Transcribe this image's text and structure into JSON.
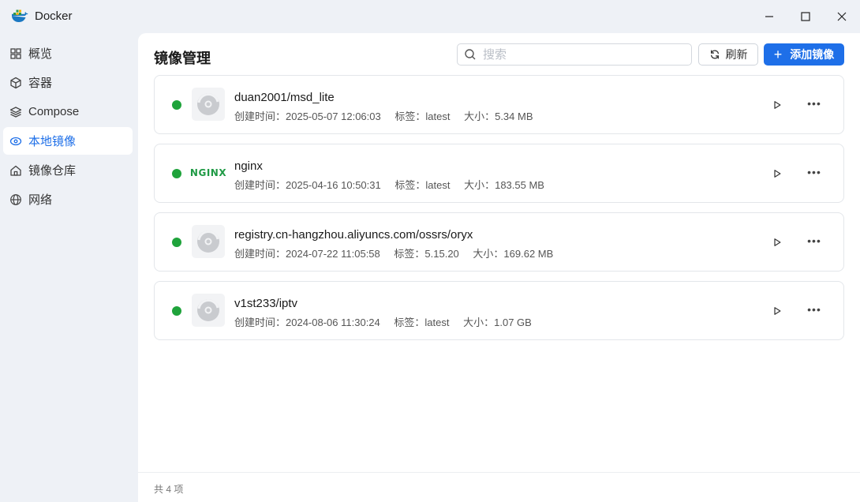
{
  "app": {
    "title": "Docker",
    "logo_icon": "docker-whale-icon"
  },
  "window_controls": [
    "minimize-icon",
    "maximize-icon",
    "close-icon"
  ],
  "sidebar": {
    "items": [
      {
        "label": "概览",
        "icon": "grid-icon",
        "active": false
      },
      {
        "label": "容器",
        "icon": "cube-icon",
        "active": false
      },
      {
        "label": "Compose",
        "icon": "layers-icon",
        "active": false
      },
      {
        "label": "本地镜像",
        "icon": "eye-disc-icon",
        "active": true
      },
      {
        "label": "镜像仓库",
        "icon": "home-icon",
        "active": false
      },
      {
        "label": "网络",
        "icon": "globe-icon",
        "active": false
      }
    ]
  },
  "main": {
    "title": "镜像管理",
    "search": {
      "placeholder": "搜索",
      "value": ""
    },
    "refresh_label": "刷新",
    "add_label": "添加镜像",
    "images": [
      {
        "name": "duan2001/msd_lite",
        "created_label": "创建时间：",
        "created": "2025-05-07 12:06:03",
        "tag_label": "标签：",
        "tag": "latest",
        "size_label": "大小：",
        "size": "5.34 MB",
        "icon": "disc-icon"
      },
      {
        "name": "nginx",
        "created_label": "创建时间：",
        "created": "2025-04-16 10:50:31",
        "tag_label": "标签：",
        "tag": "latest",
        "size_label": "大小：",
        "size": "183.55 MB",
        "icon": "nginx-logo",
        "logo_text": "NGINX"
      },
      {
        "name": "registry.cn-hangzhou.aliyuncs.com/ossrs/oryx",
        "created_label": "创建时间：",
        "created": "2024-07-22 11:05:58",
        "tag_label": "标签：",
        "tag": "5.15.20",
        "size_label": "大小：",
        "size": "169.62 MB",
        "icon": "disc-icon"
      },
      {
        "name": "v1st233/iptv",
        "created_label": "创建时间：",
        "created": "2024-08-06 11:30:24",
        "tag_label": "标签：",
        "tag": "latest",
        "size_label": "大小：",
        "size": "1.07 GB",
        "icon": "disc-icon"
      }
    ],
    "footer": "共 4 项"
  },
  "colors": {
    "accent": "#1e6fe8",
    "status_running": "#1fa33b",
    "nginx_green": "#1f9a45"
  }
}
